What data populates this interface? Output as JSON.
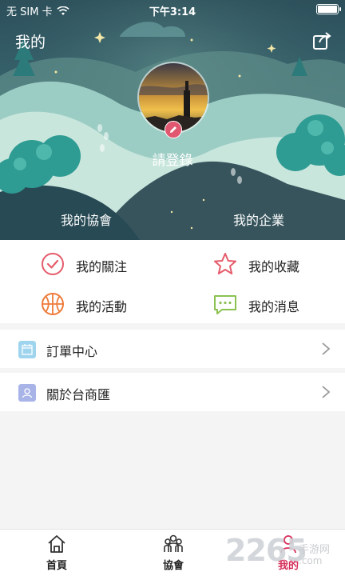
{
  "status_bar": {
    "carrier": "无 SIM 卡",
    "time": "下午3:14",
    "battery_level": 1.0
  },
  "header": {
    "title": "我的",
    "share_icon": "share-icon"
  },
  "profile": {
    "login_label": "請登錄",
    "edit_icon": "pencil-icon",
    "avatar_icon": "avatar-photo"
  },
  "hero_tabs": {
    "associations": "我的協會",
    "enterprises": "我的企業"
  },
  "quick_actions": [
    {
      "label": "我的關注",
      "icon": "check-circle-icon",
      "color": "#e55b6b"
    },
    {
      "label": "我的收藏",
      "icon": "star-icon",
      "color": "#e55b6b"
    },
    {
      "label": "我的活動",
      "icon": "basketball-icon",
      "color": "#ee7b3a"
    },
    {
      "label": "我的消息",
      "icon": "chat-bubble-icon",
      "color": "#8cc152"
    }
  ],
  "list": [
    {
      "label": "訂單中心",
      "icon": "calendar-icon",
      "color": "#9fd4ee"
    },
    {
      "label": "關於台商匯",
      "icon": "user-card-icon",
      "color": "#a8b4e8"
    }
  ],
  "bottom_nav": {
    "items": [
      {
        "label": "首頁",
        "icon": "home-icon",
        "active": false
      },
      {
        "label": "協會",
        "icon": "group-icon",
        "active": false
      },
      {
        "label": "我的",
        "icon": "person-icon",
        "active": true
      }
    ],
    "active_color": "#d62f5a"
  },
  "watermark": {
    "number": "2265",
    "text": "手游网",
    "url": ".com"
  }
}
